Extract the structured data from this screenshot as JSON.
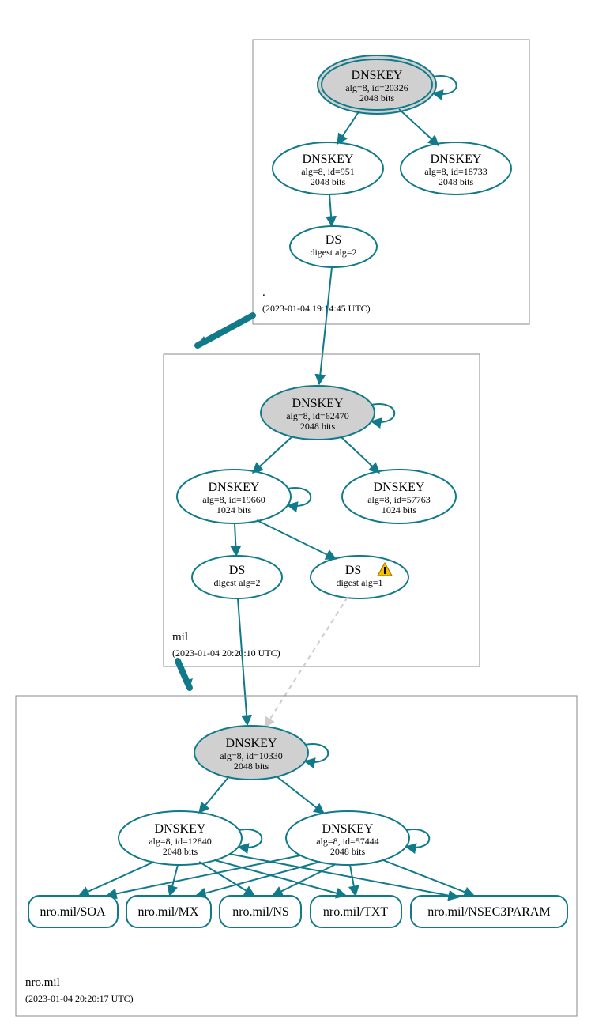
{
  "colors": {
    "stroke": "#117a8a",
    "ksk_fill": "#d0d0d0"
  },
  "zones": {
    "root": {
      "label": ".",
      "timestamp": "(2023-01-04 19:14:45 UTC)"
    },
    "mil": {
      "label": "mil",
      "timestamp": "(2023-01-04 20:20:10 UTC)"
    },
    "nro": {
      "label": "nro.mil",
      "timestamp": "(2023-01-04 20:20:17 UTC)"
    }
  },
  "nodes": {
    "root_ksk": {
      "title": "DNSKEY",
      "line2": "alg=8, id=20326",
      "line3": "2048 bits"
    },
    "root_zsk1": {
      "title": "DNSKEY",
      "line2": "alg=8, id=951",
      "line3": "2048 bits"
    },
    "root_zsk2": {
      "title": "DNSKEY",
      "line2": "alg=8, id=18733",
      "line3": "2048 bits"
    },
    "root_ds": {
      "title": "DS",
      "line2": "digest alg=2"
    },
    "mil_ksk": {
      "title": "DNSKEY",
      "line2": "alg=8, id=62470",
      "line3": "2048 bits"
    },
    "mil_zsk1": {
      "title": "DNSKEY",
      "line2": "alg=8, id=19660",
      "line3": "1024 bits"
    },
    "mil_zsk2": {
      "title": "DNSKEY",
      "line2": "alg=8, id=57763",
      "line3": "1024 bits"
    },
    "mil_ds1": {
      "title": "DS",
      "line2": "digest alg=2"
    },
    "mil_ds2": {
      "title": "DS",
      "line2": "digest alg=1"
    },
    "nro_ksk": {
      "title": "DNSKEY",
      "line2": "alg=8, id=10330",
      "line3": "2048 bits"
    },
    "nro_zsk1": {
      "title": "DNSKEY",
      "line2": "alg=8, id=12840",
      "line3": "2048 bits"
    },
    "nro_zsk2": {
      "title": "DNSKEY",
      "line2": "alg=8, id=57444",
      "line3": "2048 bits"
    }
  },
  "rr": {
    "soa": "nro.mil/SOA",
    "mx": "nro.mil/MX",
    "ns": "nro.mil/NS",
    "txt": "nro.mil/TXT",
    "nsec": "nro.mil/NSEC3PARAM"
  }
}
